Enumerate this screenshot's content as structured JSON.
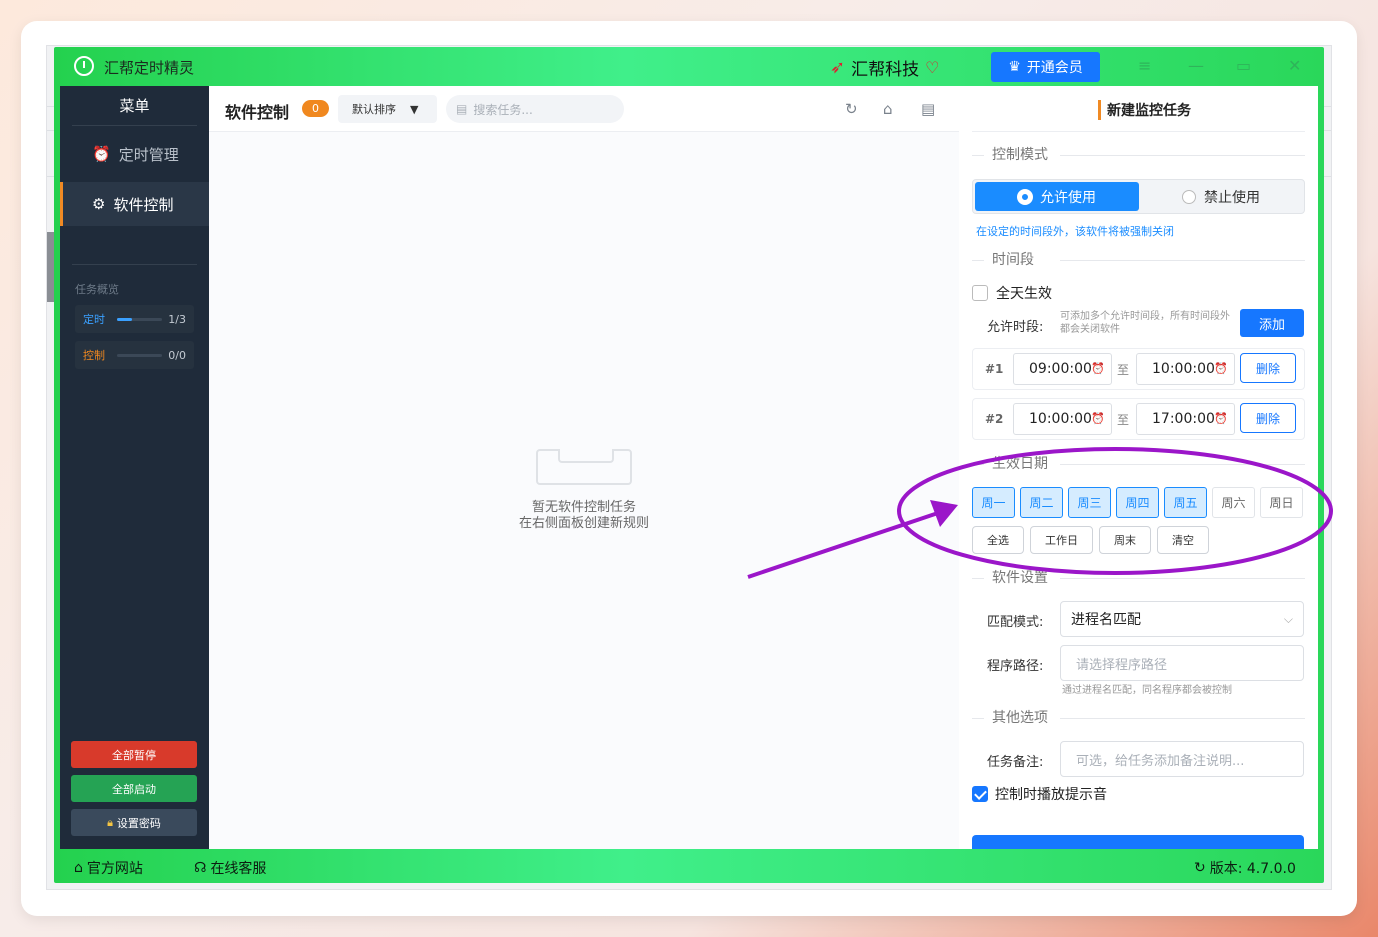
{
  "titlebar": {
    "app_title": "汇帮定时精灵",
    "brand": "汇帮科技",
    "vip_label": "开通会员",
    "menu_glyph": "≡",
    "min_glyph": "—",
    "max_glyph": "▭",
    "close_glyph": "✕"
  },
  "sidebar": {
    "title": "菜单",
    "items": [
      {
        "label": "定时管理",
        "icon": "alarm-clock-icon"
      },
      {
        "label": "软件控制",
        "icon": "gear-icon"
      }
    ],
    "overview_title": "任务概览",
    "overview": [
      {
        "label": "定时",
        "value": "1/3",
        "progress": 0.33,
        "color": "#3aa0ff"
      },
      {
        "label": "控制",
        "value": "0/0",
        "progress": 0,
        "color": "#f0881f"
      }
    ],
    "pause_all": "全部暂停",
    "start_all": "全部启动",
    "set_password": "设置密码"
  },
  "center": {
    "title": "软件控制",
    "count": "0",
    "sort_label": "默认排序",
    "search_placeholder": "搜索任务...",
    "empty_line1": "暂无软件控制任务",
    "empty_line2": "在右侧面板创建新规则"
  },
  "panel": {
    "title": "新建监控任务",
    "control_mode_section": "控制模式",
    "allow_label": "允许使用",
    "deny_label": "禁止使用",
    "mode_hint": "在设定的时间段外，该软件将被强制关闭",
    "time_section": "时间段",
    "all_day_label": "全天生效",
    "allow_period_label": "允许时段:",
    "allow_period_hint": "可添加多个允许时间段，所有时间段外都会关闭软件",
    "add_label": "添加",
    "slots": [
      {
        "no": "#1",
        "start": "09:00:00",
        "end": "10:00:00"
      },
      {
        "no": "#2",
        "start": "10:00:00",
        "end": "17:00:00"
      }
    ],
    "to_label": "至",
    "delete_label": "删除",
    "date_section": "生效日期",
    "days": [
      {
        "label": "周一",
        "on": true
      },
      {
        "label": "周二",
        "on": true
      },
      {
        "label": "周三",
        "on": true
      },
      {
        "label": "周四",
        "on": true
      },
      {
        "label": "周五",
        "on": true
      },
      {
        "label": "周六",
        "on": false
      },
      {
        "label": "周日",
        "on": false
      }
    ],
    "quick": [
      "全选",
      "工作日",
      "周末",
      "清空"
    ],
    "software_section": "软件设置",
    "match_label": "匹配模式:",
    "match_value": "进程名匹配",
    "path_label": "程序路径:",
    "path_placeholder": "请选择程序路径",
    "path_hint": "通过进程名匹配，同名程序都会被控制",
    "other_section": "其他选项",
    "note_label": "任务备注:",
    "note_placeholder": "可选，给任务添加备注说明...",
    "sound_label": "控制时播放提示音",
    "sound_checked": true
  },
  "footer": {
    "website": "官方网站",
    "support": "在线客服",
    "version": "版本: 4.7.0.0"
  },
  "colors": {
    "accent": "#1677ff",
    "green": "#2ad75a",
    "annotation": "#9b16c9"
  }
}
